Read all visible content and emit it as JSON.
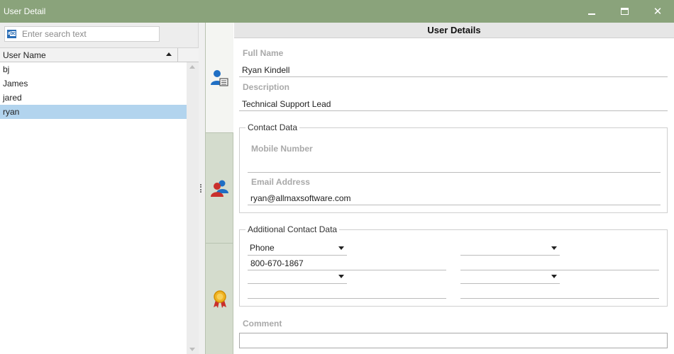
{
  "window": {
    "title": "User Detail",
    "controls": {
      "minimize": "minimize-icon",
      "maximize": "maximize-icon",
      "close": "close-icon",
      "close_glyph": "✕"
    }
  },
  "search": {
    "placeholder": "Enter search text",
    "value": "",
    "icon": "abc-search-icon"
  },
  "users_table": {
    "column_header": "User Name",
    "sort": "ascending",
    "rows": [
      "bj",
      "James",
      "jared",
      "ryan"
    ],
    "selected": "ryan"
  },
  "tabs": [
    {
      "name": "user-details",
      "icon": "user-card-icon",
      "active": true
    },
    {
      "name": "user-groups",
      "icon": "user-group-icon",
      "active": false
    },
    {
      "name": "permissions",
      "icon": "award-ribbon-icon",
      "active": false
    }
  ],
  "details": {
    "header": "User Details",
    "full_name_label": "Full Name",
    "full_name": "Ryan Kindell",
    "description_label": "Description",
    "description": "Technical Support Lead",
    "contact": {
      "legend": "Contact Data",
      "mobile_label": "Mobile Number",
      "mobile": "",
      "email_label": "Email Address",
      "email": "ryan@allmaxsoftware.com"
    },
    "additional": {
      "legend": "Additional Contact Data",
      "type_1": "Phone",
      "value_1": "800-670-1867",
      "type_2": "",
      "value_2": "",
      "type_3": "",
      "value_3": "",
      "type_4": "",
      "value_4": ""
    },
    "comment_label": "Comment",
    "comment": ""
  },
  "colors": {
    "titlebar": "#8aa37b",
    "selection": "#b2d4ee",
    "tabstrip": "#d4dccd",
    "label_gray": "#a9a9a9"
  }
}
